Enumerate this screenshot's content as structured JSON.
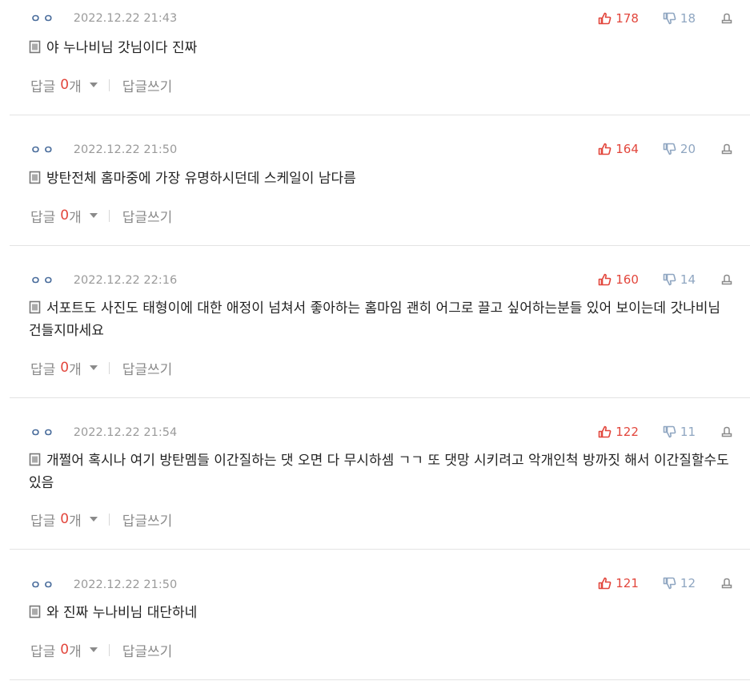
{
  "comments": [
    {
      "nick": "ㅇㅇ",
      "date": "2022.12.22 21:43",
      "up": "178",
      "down": "18",
      "text": "야 누나비님 갓님이다 진짜",
      "reply_label": "답글",
      "reply_count": "0",
      "reply_unit": "개",
      "write_label": "답글쓰기"
    },
    {
      "nick": "ㅇㅇ",
      "date": "2022.12.22 21:50",
      "up": "164",
      "down": "20",
      "text": "방탄전체 홈마중에 가장 유명하시던데 스케일이 남다름",
      "reply_label": "답글",
      "reply_count": "0",
      "reply_unit": "개",
      "write_label": "답글쓰기"
    },
    {
      "nick": "ㅇㅇ",
      "date": "2022.12.22 22:16",
      "up": "160",
      "down": "14",
      "text": "서포트도 사진도 태형이에 대한 애정이 넘쳐서 좋아하는 홈마임 괜히 어그로 끌고 싶어하는분들 있어 보이는데 갓나비님 건들지마세요",
      "reply_label": "답글",
      "reply_count": "0",
      "reply_unit": "개",
      "write_label": "답글쓰기"
    },
    {
      "nick": "ㅇㅇ",
      "date": "2022.12.22 21:54",
      "up": "122",
      "down": "11",
      "text": "개쩔어 혹시나 여기 방탄멤들 이간질하는 댓 오면 다 무시하셈 ㄱㄱ 또 댓망 시키려고 악개인척 방까짓 해서 이간질할수도있음",
      "reply_label": "답글",
      "reply_count": "0",
      "reply_unit": "개",
      "write_label": "답글쓰기"
    },
    {
      "nick": "ㅇㅇ",
      "date": "2022.12.22 21:50",
      "up": "121",
      "down": "12",
      "text": "와 진짜 누나비님 대단하네",
      "reply_label": "답글",
      "reply_count": "0",
      "reply_unit": "개",
      "write_label": "답글쓰기"
    }
  ],
  "icons": {
    "doc": "document-icon",
    "up": "thumbs-up-icon",
    "down": "thumbs-down-icon",
    "report": "report-icon",
    "caret": "caret-down-icon"
  },
  "colors": {
    "accent": "#e2463c",
    "nick": "#4a6d9c",
    "down": "#8fa6c1",
    "muted": "#8a8a8a"
  }
}
